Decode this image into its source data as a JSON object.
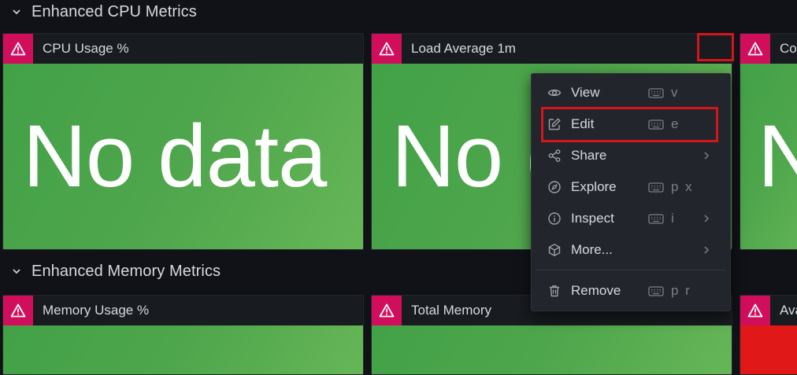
{
  "rows": [
    {
      "title": "Enhanced CPU Metrics"
    },
    {
      "title": "Enhanced Memory Metrics"
    }
  ],
  "panels": {
    "cpu_usage": {
      "title": "CPU Usage %",
      "value": "No data"
    },
    "load_avg": {
      "title": "Load Average 1m",
      "value": "No data"
    },
    "third_top": {
      "title": "Co",
      "value": "N"
    },
    "memory_usage": {
      "title": "Memory Usage %"
    },
    "total_memory": {
      "title": "Total Memory"
    },
    "third_bottom": {
      "title": "Ava"
    }
  },
  "menu": {
    "items": [
      {
        "label": "View",
        "shortcut": "v",
        "icon": "eye-icon"
      },
      {
        "label": "Edit",
        "shortcut": "e",
        "icon": "edit-icon"
      },
      {
        "label": "Share",
        "icon": "share-icon"
      },
      {
        "label": "Explore",
        "shortcut": "p x",
        "icon": "compass-icon"
      },
      {
        "label": "Inspect",
        "shortcut": "i",
        "icon": "info-icon"
      },
      {
        "label": "More...",
        "icon": "cube-icon"
      },
      {
        "label": "Remove",
        "shortcut": "p r",
        "icon": "trash-icon"
      }
    ]
  },
  "colors": {
    "background": "#111217",
    "panel": "#181b1f",
    "warning": "#d10e5c",
    "stat_green": "#4fa64c",
    "stat_red": "#e01818",
    "highlight": "#d5151c",
    "menu": "#22252b"
  }
}
